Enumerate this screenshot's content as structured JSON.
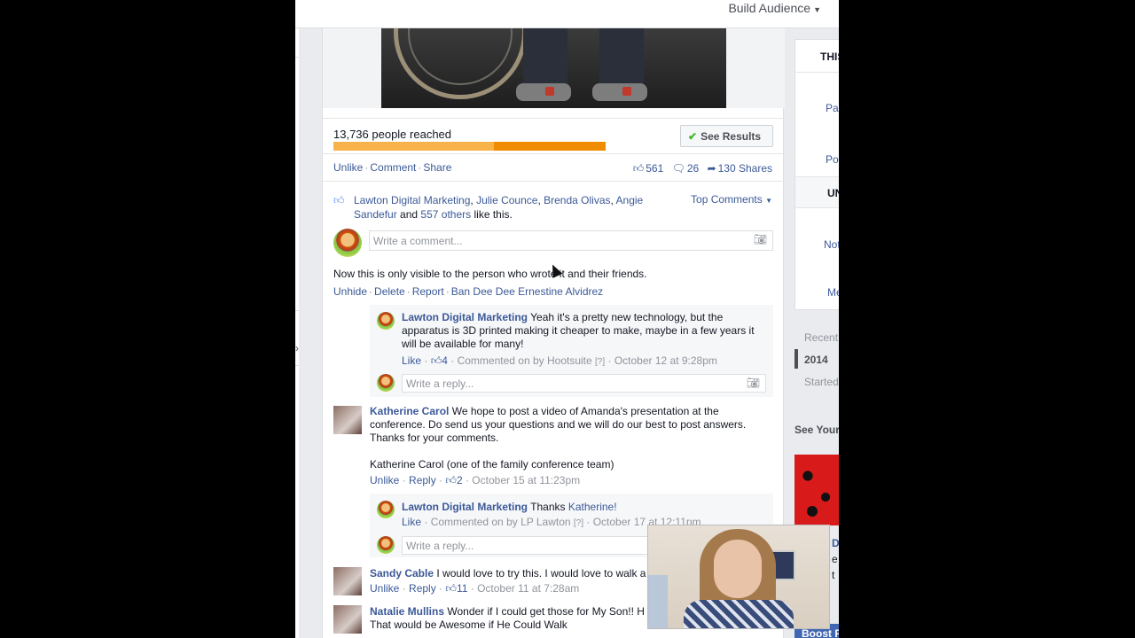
{
  "topbar": {
    "build_audience": "Build Audience"
  },
  "post": {
    "reach_text": "13,736 people reached",
    "reach_fraction": 0.41,
    "see_results": "See Results",
    "actions": [
      "Unlike",
      "Comment",
      "Share"
    ],
    "likes_count": "561",
    "comments_count": "26",
    "shares_text": "130 Shares",
    "likers": [
      "Lawton Digital Marketing",
      "Julie Counce",
      "Brenda Olivas",
      "Angie Sandefur"
    ],
    "likers_and": "and",
    "others_link": "557 others",
    "likers_suffix": "like this.",
    "top_comments": "Top Comments",
    "write_comment_placeholder": "Write a comment..."
  },
  "hidden_comment": {
    "note": "Now this is only visible to the person who wrote it and their friends.",
    "actions": [
      "Unhide",
      "Delete",
      "Report",
      "Ban Dee Dee Ernestine Alvidrez"
    ]
  },
  "reply1": {
    "name": "Lawton Digital Marketing",
    "text": "Yeah it's a pretty new technology, but the apparatus is 3D printed making it cheaper to make, maybe in a few years it will be available for many!",
    "like": "Like",
    "like_count": "4",
    "meta": "Commented on by Hootsuite",
    "help": "[?]",
    "time": "October 12 at 9:28pm",
    "reply_placeholder": "Write a reply..."
  },
  "comment_katherine": {
    "name": "Katherine Carol",
    "text": "We hope to post a video of Amanda's presentation at the conference. Do send us your questions and we will do our best to post answers. Thanks for your comments.",
    "signature": "Katherine Carol (one of the family conference team)",
    "unlike": "Unlike",
    "reply": "Reply",
    "like_count": "2",
    "time": "October 15 at 11:23pm"
  },
  "reply2": {
    "name": "Lawton Digital Marketing",
    "text": "Thanks",
    "mention": "Katherine!",
    "like": "Like",
    "meta": "Commented on by LP Lawton",
    "help": "[?]",
    "time": "October 17 at 12:11pm",
    "reply_placeholder": "Write a reply..."
  },
  "comment_sandy": {
    "name": "Sandy Cable",
    "text": "I would love to try this. I would love to walk a",
    "unlike": "Unlike",
    "reply": "Reply",
    "like_count": "11",
    "time": "October 11 at 7:28am"
  },
  "comment_natalie": {
    "name": "Natalie Mullins",
    "text": "Wonder if I could get those for My Son!! H",
    "text2": "That would be Awesome if He Could Walk"
  },
  "right_column": {
    "this_header": "THIS",
    "page": "Pag",
    "posts": "Pos",
    "un_header": "UN",
    "not": "Not",
    "me": "Me",
    "recent": "Recent",
    "year_2014": "2014",
    "started": "Started",
    "see_your": "See Your",
    "boost": "Boost P",
    "d": "D",
    "e": "e",
    "t": "t"
  },
  "colors": {
    "link": "#3b5998",
    "reach_fill": "#f08c00",
    "reach_bg": "#f7b34a"
  }
}
